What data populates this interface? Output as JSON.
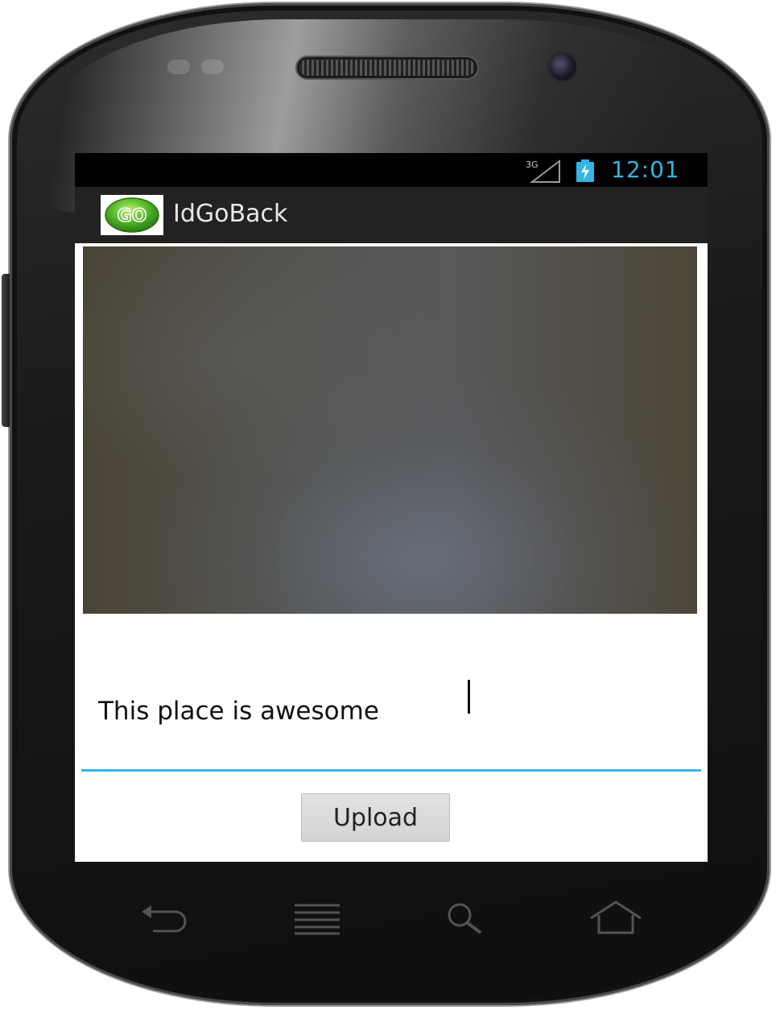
{
  "status_bar": {
    "network_label": "3G",
    "time": "12:01",
    "accent_color": "#33b5e5"
  },
  "action_bar": {
    "app_icon_text": "GO",
    "app_title": "IdGoBack"
  },
  "photo": {
    "description_icon": "camera-photo-preview"
  },
  "comment_input": {
    "value": "This place is awesome"
  },
  "upload_button": {
    "label": "Upload"
  },
  "navigation_keys": [
    {
      "icon": "back-icon"
    },
    {
      "icon": "menu-icon"
    },
    {
      "icon": "search-icon"
    },
    {
      "icon": "home-icon"
    }
  ]
}
